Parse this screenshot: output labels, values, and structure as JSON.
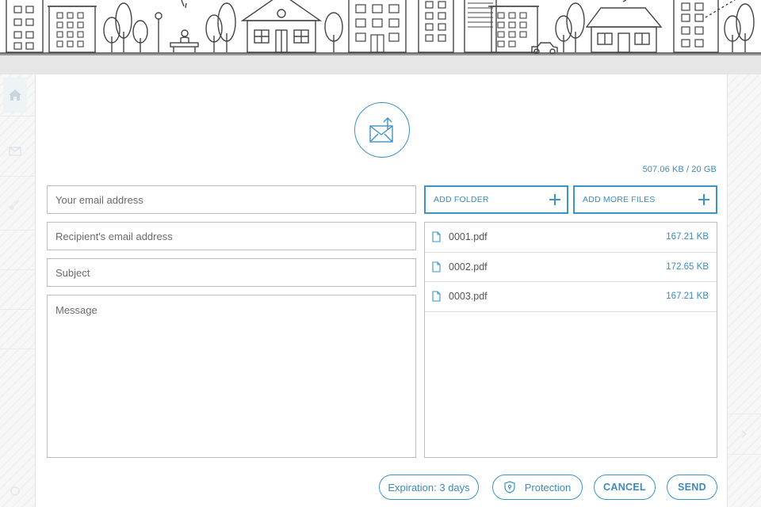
{
  "colors": {
    "accent": "#3b94c4",
    "line_art": "#444444",
    "border": "#bdbdbd"
  },
  "upload": {
    "quota": "507.06 KB / 20 GB"
  },
  "form": {
    "email_placeholder": "Your email address",
    "recipient_placeholder": "Recipient's email address",
    "subject_placeholder": "Subject",
    "message_placeholder": "Message"
  },
  "actions": {
    "add_folder": "ADD FOLDER",
    "add_more_files": "ADD MORE FILES",
    "expiration": "Expiration: 3 days",
    "protection": "Protection",
    "cancel": "CANCEL",
    "send": "SEND"
  },
  "files": [
    {
      "name": "0001.pdf",
      "size": "167.21 KB"
    },
    {
      "name": "0002.pdf",
      "size": "172.65 KB"
    },
    {
      "name": "0003.pdf",
      "size": "167.21 KB"
    }
  ],
  "icons": {
    "logo": "envelope-upload-icon",
    "file": "document-icon",
    "add": "plus-icon",
    "protection": "shield-icon",
    "rail_home": "home-icon"
  }
}
